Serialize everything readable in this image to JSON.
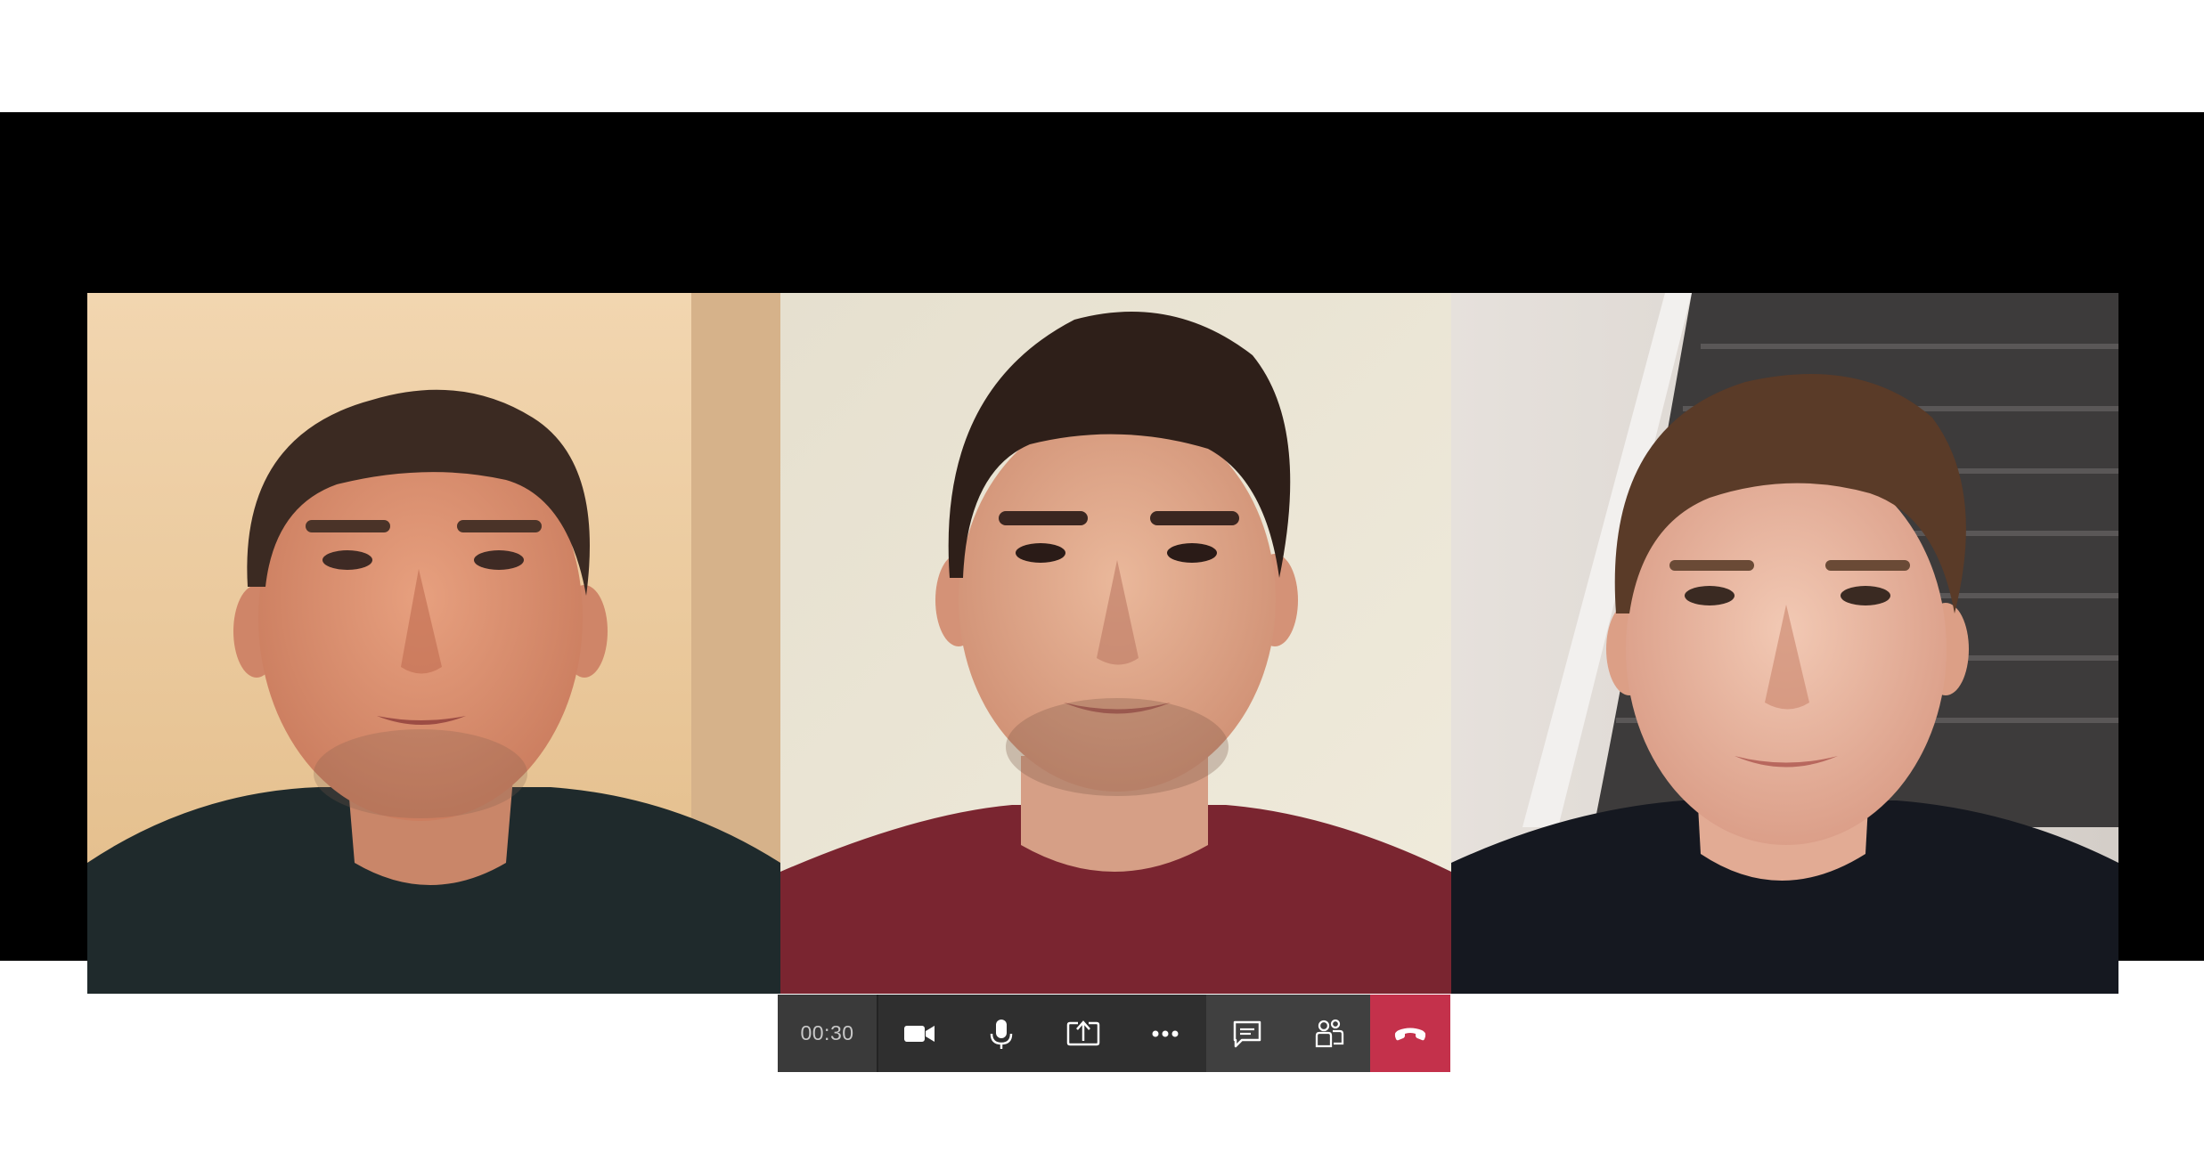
{
  "call": {
    "timer": "00:30",
    "participants": [
      {
        "tile": "participant-video-1"
      },
      {
        "tile": "participant-video-2"
      },
      {
        "tile": "participant-video-3"
      }
    ]
  },
  "toolbar": {
    "buttons": [
      {
        "icon": "video-camera-icon"
      },
      {
        "icon": "microphone-icon"
      },
      {
        "icon": "share-screen-icon"
      },
      {
        "icon": "more-options-icon"
      },
      {
        "icon": "chat-icon"
      },
      {
        "icon": "participants-icon"
      },
      {
        "icon": "hang-up-icon"
      }
    ]
  },
  "colors": {
    "stage_background": "#000000",
    "toolbar_dark": "#2f2f2f",
    "toolbar_light": "#404040",
    "timer_background": "#3a3a3a",
    "hangup_red": "#c4314b",
    "icon_white": "#ffffff"
  }
}
